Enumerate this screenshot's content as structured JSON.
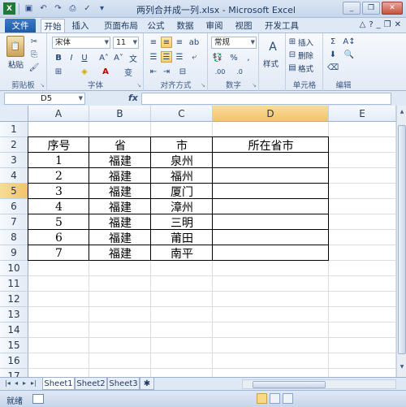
{
  "window": {
    "title": "两列合并成一列.xlsx - Microsoft Excel"
  },
  "ribbon_tabs": [
    "文件",
    "开始",
    "插入",
    "页面布局",
    "公式",
    "数据",
    "审阅",
    "视图",
    "开发工具"
  ],
  "ribbon": {
    "clipboard": {
      "paste": "粘贴",
      "label": "剪贴板"
    },
    "font": {
      "name": "宋体",
      "size": "11",
      "label": "字体"
    },
    "alignment": {
      "label": "对齐方式"
    },
    "number": {
      "format": "常规",
      "label": "数字"
    },
    "styles": {
      "label": "样式"
    },
    "cells": {
      "insert": "插入",
      "delete": "删除",
      "format": "格式",
      "label": "单元格"
    },
    "editing": {
      "label": "编辑"
    }
  },
  "formula_bar": {
    "name_box": "D5",
    "fx": "fx",
    "value": ""
  },
  "sheet": {
    "columns": [
      "A",
      "B",
      "C",
      "D",
      "E"
    ],
    "rows": [
      "1",
      "2",
      "3",
      "4",
      "5",
      "6",
      "7",
      "8",
      "9",
      "10",
      "11",
      "12",
      "13",
      "14",
      "15",
      "16",
      "17"
    ],
    "table": {
      "headers": [
        "序号",
        "省",
        "市",
        "所在省市"
      ],
      "rows": [
        [
          "1",
          "福建",
          "泉州",
          ""
        ],
        [
          "2",
          "福建",
          "福州",
          ""
        ],
        [
          "3",
          "福建",
          "厦门",
          ""
        ],
        [
          "4",
          "福建",
          "漳州",
          ""
        ],
        [
          "5",
          "福建",
          "三明",
          ""
        ],
        [
          "6",
          "福建",
          "莆田",
          ""
        ],
        [
          "7",
          "福建",
          "南平",
          ""
        ]
      ]
    }
  },
  "sheet_tabs": [
    "Sheet1",
    "Sheet2",
    "Sheet3"
  ],
  "status": {
    "ready": "就绪"
  }
}
